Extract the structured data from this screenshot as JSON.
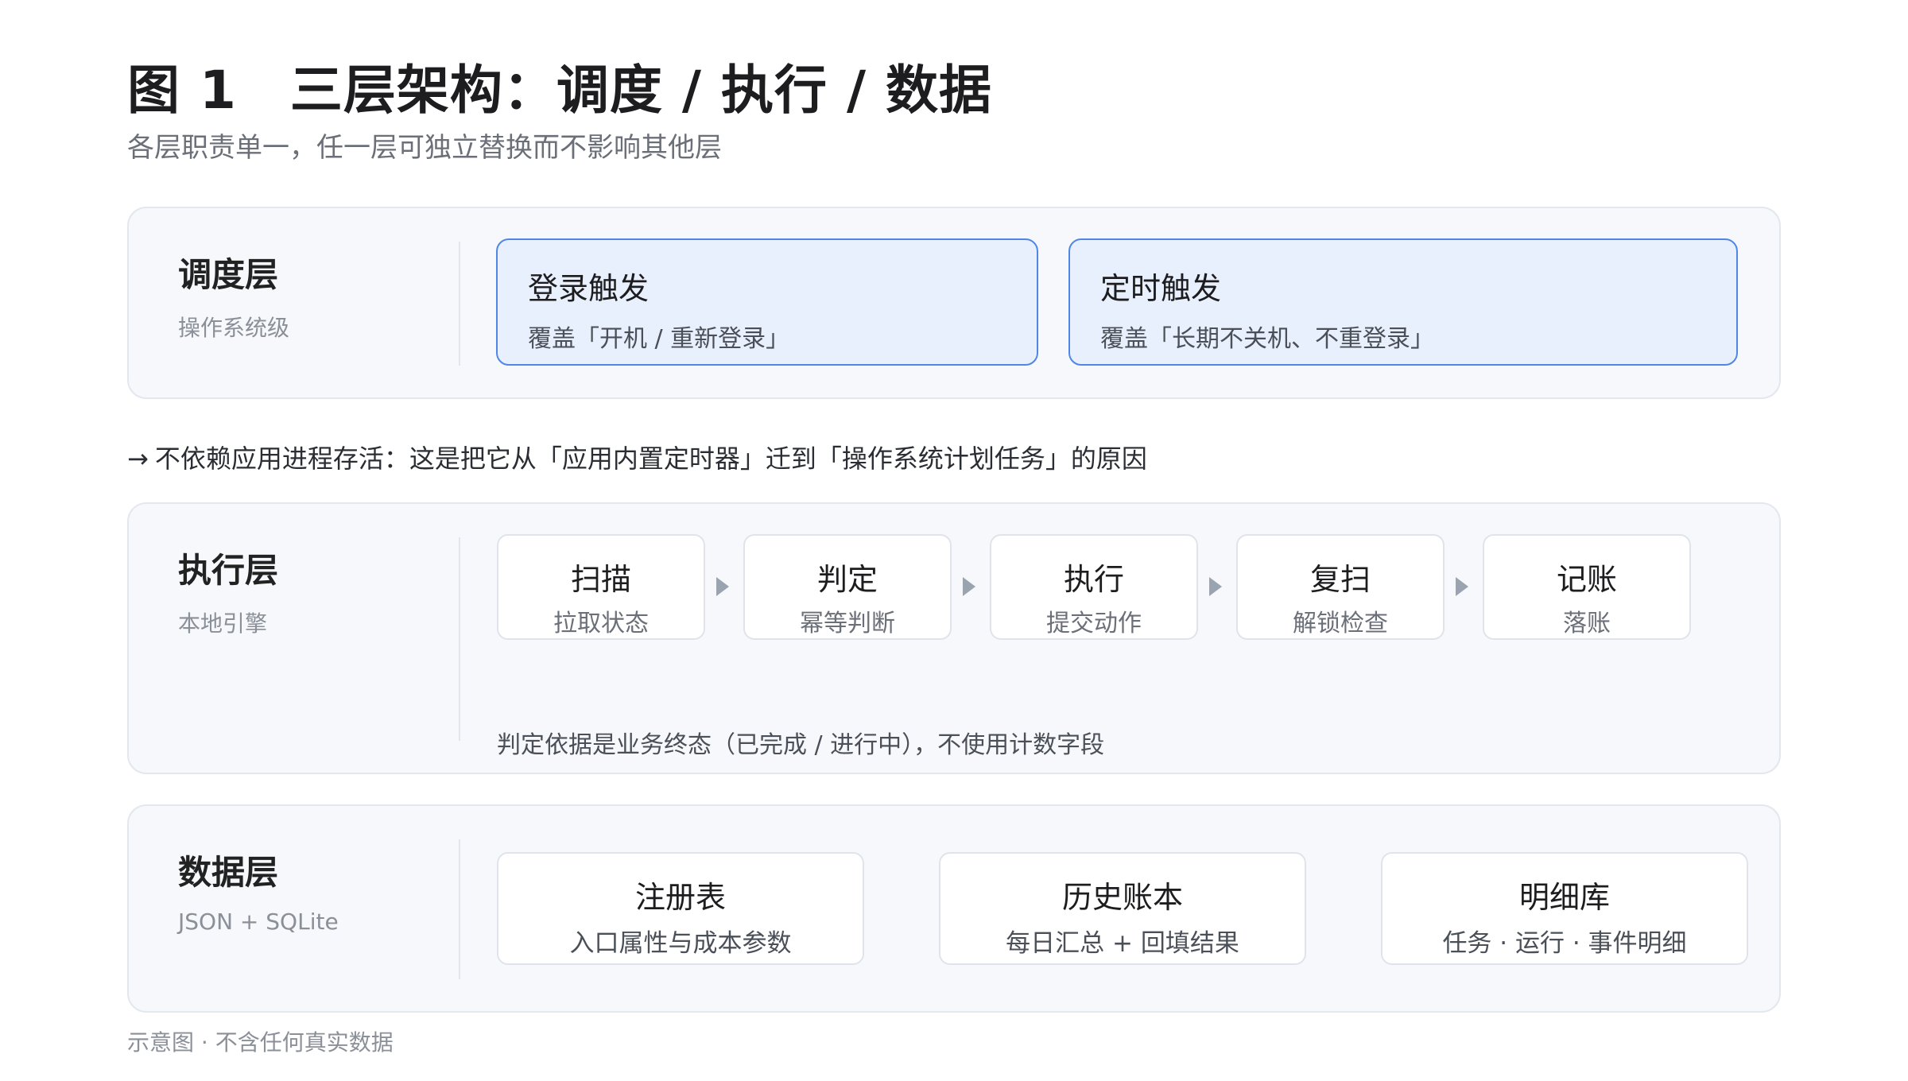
{
  "header": {
    "title": "图 1　三层架构：调度 / 执行 / 数据",
    "subtitle": "各层职责单一，任一层可独立替换而不影响其他层"
  },
  "scheduler": {
    "name": "调度层",
    "desc": "操作系统级",
    "cards": [
      {
        "title": "登录触发",
        "sub": "覆盖「开机 / 重新登录」"
      },
      {
        "title": "定时触发",
        "sub": "覆盖「长期不关机、不重登录」"
      }
    ]
  },
  "note": {
    "arrow": "→",
    "text": "不依赖应用进程存活：这是把它从「应用内置定时器」迁到「操作系统计划任务」的原因"
  },
  "executor": {
    "name": "执行层",
    "desc": "本地引擎",
    "steps": [
      {
        "title": "扫描",
        "sub": "拉取状态"
      },
      {
        "title": "判定",
        "sub": "幂等判断"
      },
      {
        "title": "执行",
        "sub": "提交动作"
      },
      {
        "title": "复扫",
        "sub": "解锁检查"
      },
      {
        "title": "记账",
        "sub": "落账"
      }
    ],
    "note": "判定依据是业务终态（已完成 / 进行中），不使用计数字段"
  },
  "data_layer": {
    "name": "数据层",
    "desc": "JSON + SQLite",
    "stores": [
      {
        "title": "注册表",
        "sub": "入口属性与成本参数"
      },
      {
        "title": "历史账本",
        "sub": "每日汇总 + 回填结果"
      },
      {
        "title": "明细库",
        "sub": "任务 · 运行 · 事件明细"
      }
    ]
  },
  "footnote": "示意图 · 不含任何真实数据",
  "colors": {
    "accent_border": "#4f86e8",
    "accent_fill": "#e9f0fd",
    "panel_bg": "#f6f8fb",
    "arrow": "#9aa3b0"
  }
}
